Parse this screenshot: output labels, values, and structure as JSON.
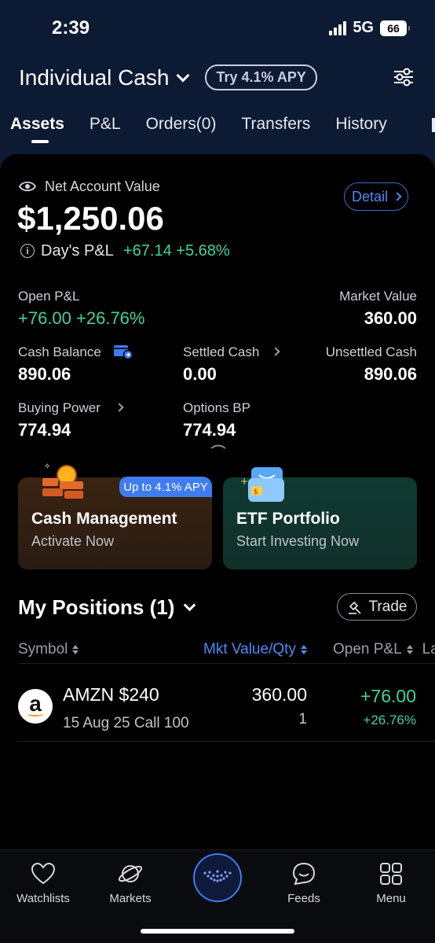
{
  "status": {
    "time": "2:39",
    "network": "5G",
    "battery": "66"
  },
  "header": {
    "account_title": "Individual Cash",
    "apy_pill": "Try 4.1% APY"
  },
  "tabs": [
    "Assets",
    "P&L",
    "Orders(0)",
    "Transfers",
    "History"
  ],
  "summary": {
    "net_label": "Net Account Value",
    "net_value": "$1,250.06",
    "detail_label": "Detail",
    "days_pl_label": "Day's P&L",
    "days_pl_value": "+67.14 +5.68%"
  },
  "metrics": {
    "open_pl_label": "Open P&L",
    "open_pl_value": "+76.00 +26.76%",
    "market_value_label": "Market Value",
    "market_value": "360.00",
    "cash_balance_label": "Cash Balance",
    "cash_balance": "890.06",
    "settled_cash_label": "Settled Cash",
    "settled_cash": "0.00",
    "unsettled_cash_label": "Unsettled Cash",
    "unsettled_cash": "890.06",
    "buying_power_label": "Buying Power",
    "buying_power": "774.94",
    "options_bp_label": "Options BP",
    "options_bp": "774.94"
  },
  "promos": {
    "cash": {
      "tag": "Up to 4.1% APY",
      "title": "Cash Management",
      "subtitle": "Activate Now"
    },
    "etf": {
      "title": "ETF Portfolio",
      "subtitle": "Start Investing Now"
    }
  },
  "positions": {
    "title": "My Positions (1)",
    "trade_label": "Trade",
    "columns": {
      "symbol": "Symbol",
      "mkt": "Mkt Value/Qty",
      "open_pl": "Open P&L",
      "last": "La"
    },
    "rows": [
      {
        "symbol": "AMZN $240",
        "detail": "15 Aug 25 Call 100",
        "mkt_value": "360.00",
        "qty": "1",
        "open_pl": "+76.00",
        "open_pl_pct": "+26.76%"
      }
    ]
  },
  "tabbar": {
    "watchlists": "Watchlists",
    "markets": "Markets",
    "feeds": "Feeds",
    "menu": "Menu"
  },
  "colors": {
    "header_bg": "#0d1a33",
    "accent_blue": "#3e7cf0",
    "gain_green": "#43d39a"
  }
}
